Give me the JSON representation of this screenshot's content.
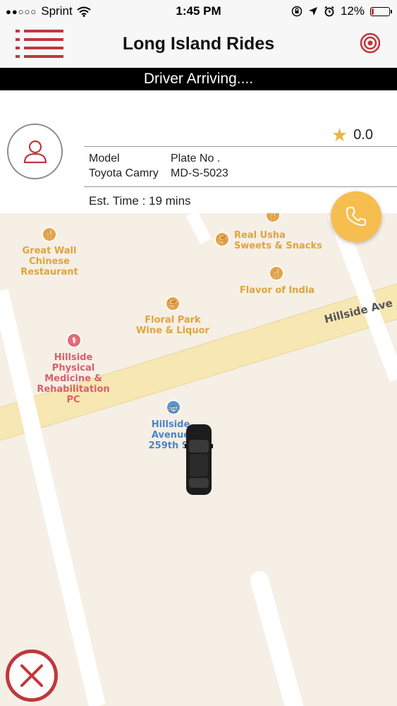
{
  "status_bar": {
    "signal_dots": "●●○○○",
    "carrier": "Sprint",
    "time": "1:45 PM",
    "battery_percent": "12%",
    "battery_level": 0.12,
    "icons": [
      "wifi-icon",
      "orientation-lock-icon",
      "location-icon",
      "alarm-icon",
      "battery-icon"
    ]
  },
  "header": {
    "title": "Long Island Rides",
    "accent_color": "#c0373d",
    "icons": [
      "menu-icon",
      "target-icon"
    ]
  },
  "banner": {
    "text": "Driver Arriving...."
  },
  "driver": {
    "rating": "0.0",
    "model_label": "Model",
    "model_value": "Toyota Camry",
    "plate_label": "Plate No .",
    "plate_value": "MD-S-5023",
    "est_time": "Est. Time : 19 mins",
    "icons": [
      "user-icon",
      "star-icon",
      "phone-icon"
    ]
  },
  "map": {
    "street_name": "Hillside Ave",
    "pois": {
      "great_wall": "Great Wall\nChinese\nRestaurant",
      "real_usha": "Real Usha\nSweets & Snacks",
      "flavor": "Flavor of India",
      "floral_park": "Floral Park\nWine & Liquor",
      "hillside_pt": "Hillside\nPhysical\nMedicine &\nRehabilitation\nPC",
      "bus_stop": "Hillside\nAvenue\n259th St"
    },
    "icons": [
      "restaurant-icon",
      "shopping-basket-icon",
      "medical-icon",
      "bus-icon",
      "car-icon",
      "cancel-icon"
    ]
  }
}
